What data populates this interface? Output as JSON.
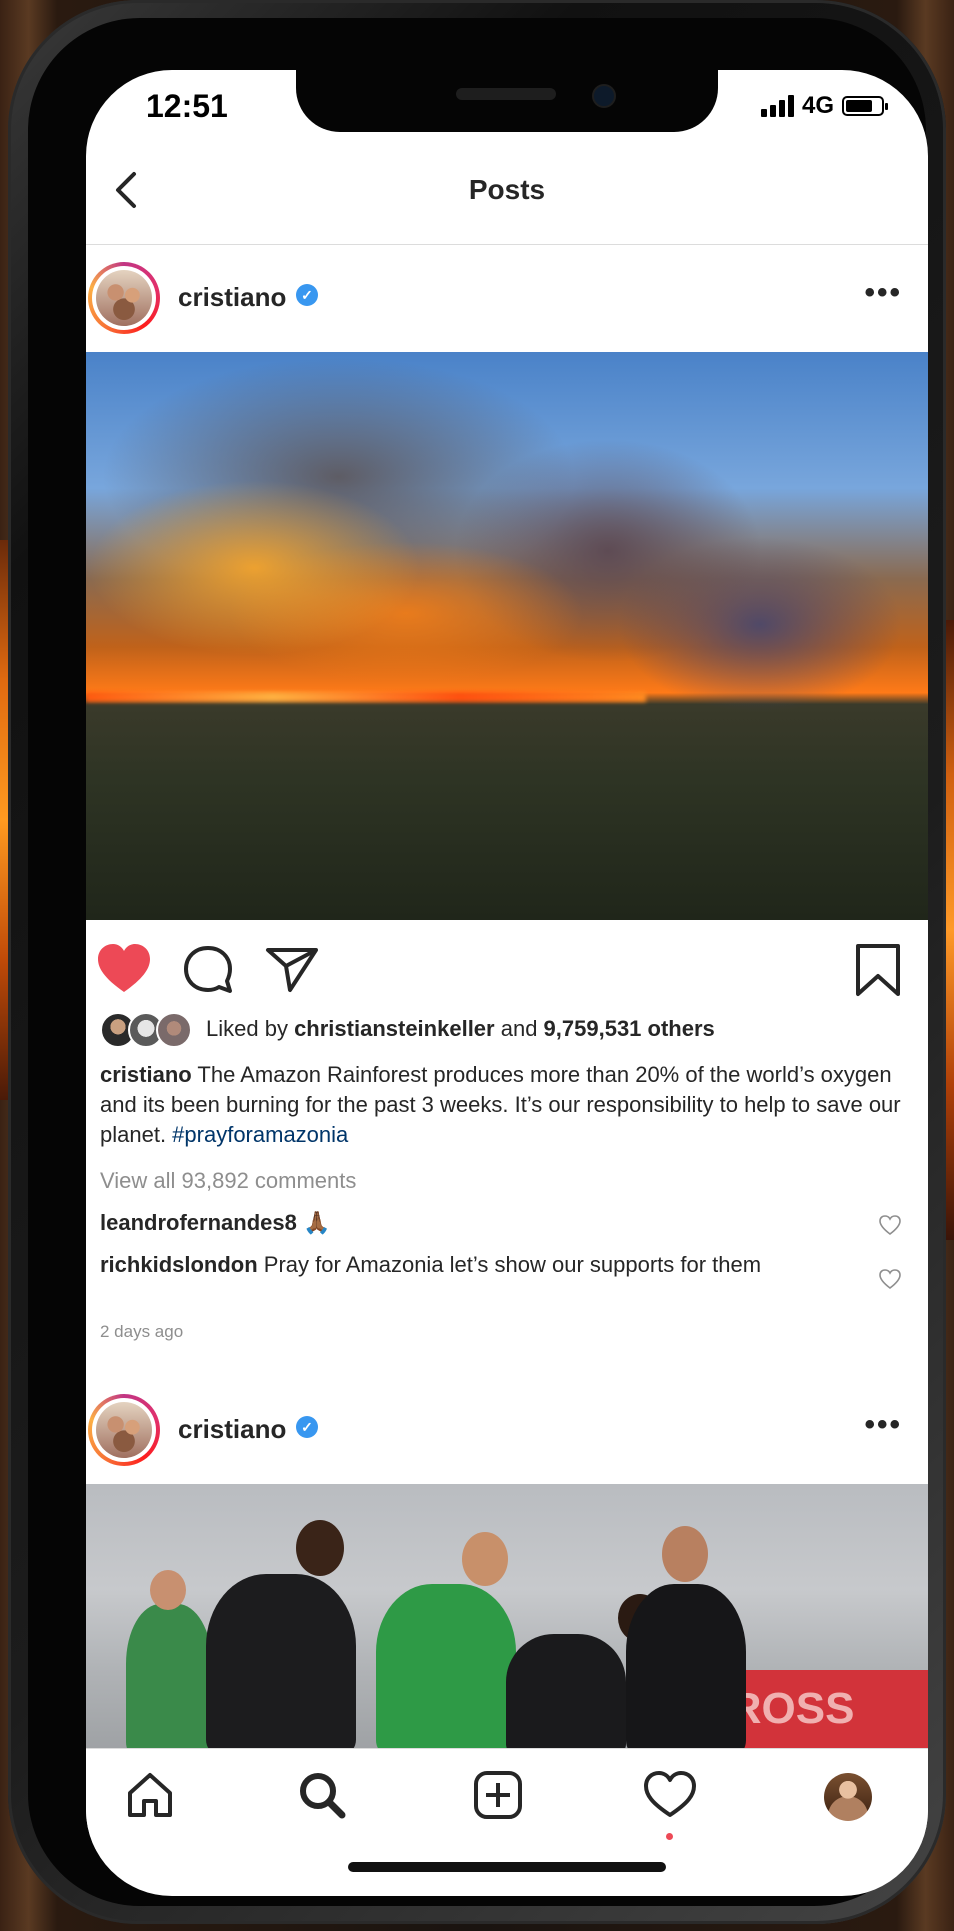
{
  "status_bar": {
    "time": "12:51",
    "network": "4G",
    "battery_level": 0.75
  },
  "nav": {
    "title": "Posts",
    "back_icon": "chevron-left-icon"
  },
  "posts": [
    {
      "username": "cristiano",
      "verified": true,
      "image": "amazon-fire-photo",
      "liked": true,
      "likes": {
        "prefix": "Liked by ",
        "user": "christiansteinkeller",
        "middle": " and ",
        "count": "9,759,531 others"
      },
      "caption": {
        "user": "cristiano",
        "text": " The Amazon Rainforest produces more than 20% of the world’s oxygen and its been burning for the past 3 weeks. It’s our responsibility to help to save our planet. ",
        "hashtag": "#prayforamazonia"
      },
      "view_all_comments": "View all 93,892 comments",
      "comments": [
        {
          "user": "leandrofernandes8",
          "text": " 🙏🏾"
        },
        {
          "user": "richkidslondon",
          "text": " Pray for Amazonia let’s show our supports for them"
        }
      ],
      "time_ago": "2 days ago"
    },
    {
      "username": "cristiano",
      "verified": true,
      "image": "football-training-photo",
      "banner_text": "AROSS"
    }
  ],
  "tabbar": {
    "items": [
      "home-icon",
      "search-icon",
      "new-post-icon",
      "activity-icon",
      "profile-avatar"
    ],
    "activity_dot": true
  },
  "colors": {
    "like_red": "#ed4956",
    "verified_blue": "#3897f0",
    "hashtag_blue": "#003569",
    "muted_gray": "#8e8e8e"
  }
}
